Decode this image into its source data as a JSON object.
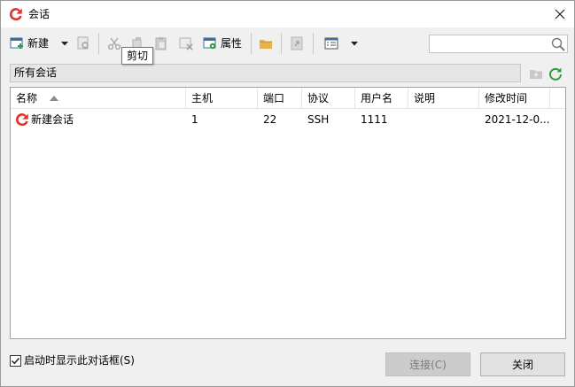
{
  "window": {
    "title": "会话"
  },
  "toolbar": {
    "new_label": "新建",
    "properties_label": "属性",
    "tooltip": "剪切"
  },
  "search": {
    "value": "",
    "placeholder": ""
  },
  "path": {
    "label": "所有会话"
  },
  "table": {
    "columns": [
      "名称",
      "主机",
      "端口",
      "协议",
      "用户名",
      "说明",
      "修改时间"
    ],
    "rows": [
      {
        "name": "新建会话",
        "host": "1",
        "port": "22",
        "protocol": "SSH",
        "username": "1111",
        "description": "",
        "modified": "2021-12-0..."
      }
    ]
  },
  "footer": {
    "show_on_startup_label": "启动时显示此对话框(S)",
    "show_on_startup_checked": true,
    "connect_label": "连接(C)",
    "close_label": "关闭"
  },
  "colors": {
    "accent_red": "#e0342b",
    "refresh_green": "#2f9e3f",
    "folder_orange": "#e8b04a"
  }
}
